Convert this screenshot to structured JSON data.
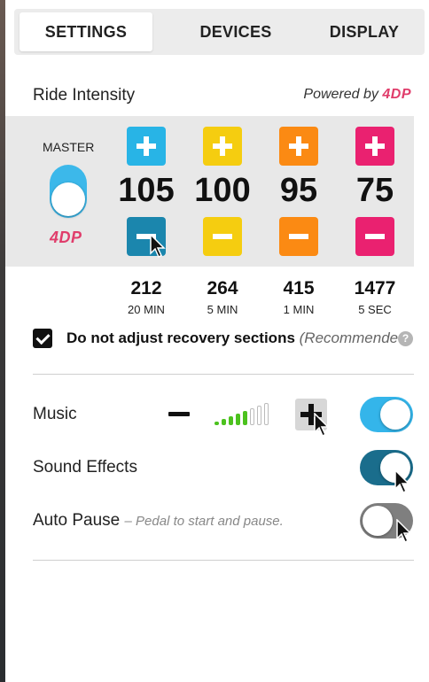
{
  "tabs": [
    {
      "label": "SETTINGS"
    },
    {
      "label": "DEVICES"
    },
    {
      "label": "DISPLAY"
    }
  ],
  "ride_intensity": {
    "label": "Ride Intensity",
    "powered_by": "Powered by",
    "brand": "4DP"
  },
  "master": {
    "label": "MASTER",
    "brand": "4DP",
    "enabled": true
  },
  "intensity_columns": [
    {
      "value": "105",
      "best": "212",
      "duration": "20 MIN",
      "color": "#28b4e6"
    },
    {
      "value": "100",
      "best": "264",
      "duration": "5 MIN",
      "color": "#f5cd10"
    },
    {
      "value": "95",
      "best": "415",
      "duration": "1 MIN",
      "color": "#fb8a13"
    },
    {
      "value": "75",
      "best": "1477",
      "duration": "5 SEC",
      "color": "#ea2170"
    }
  ],
  "recovery": {
    "checked": true,
    "label": "Do not adjust recovery sections",
    "note": "(Recommended)",
    "help": "?"
  },
  "music": {
    "label": "Music",
    "volume_level": 5,
    "volume_max": 8,
    "toggle_on": true,
    "toggle_color": "#34b5ea"
  },
  "sound_effects": {
    "label": "Sound Effects",
    "toggle_on": true,
    "toggle_color": "#1a6d8c"
  },
  "auto_pause": {
    "label": "Auto Pause",
    "description": "– Pedal to start and pause.",
    "toggle_on": false,
    "toggle_color": "#7f7f7f"
  }
}
